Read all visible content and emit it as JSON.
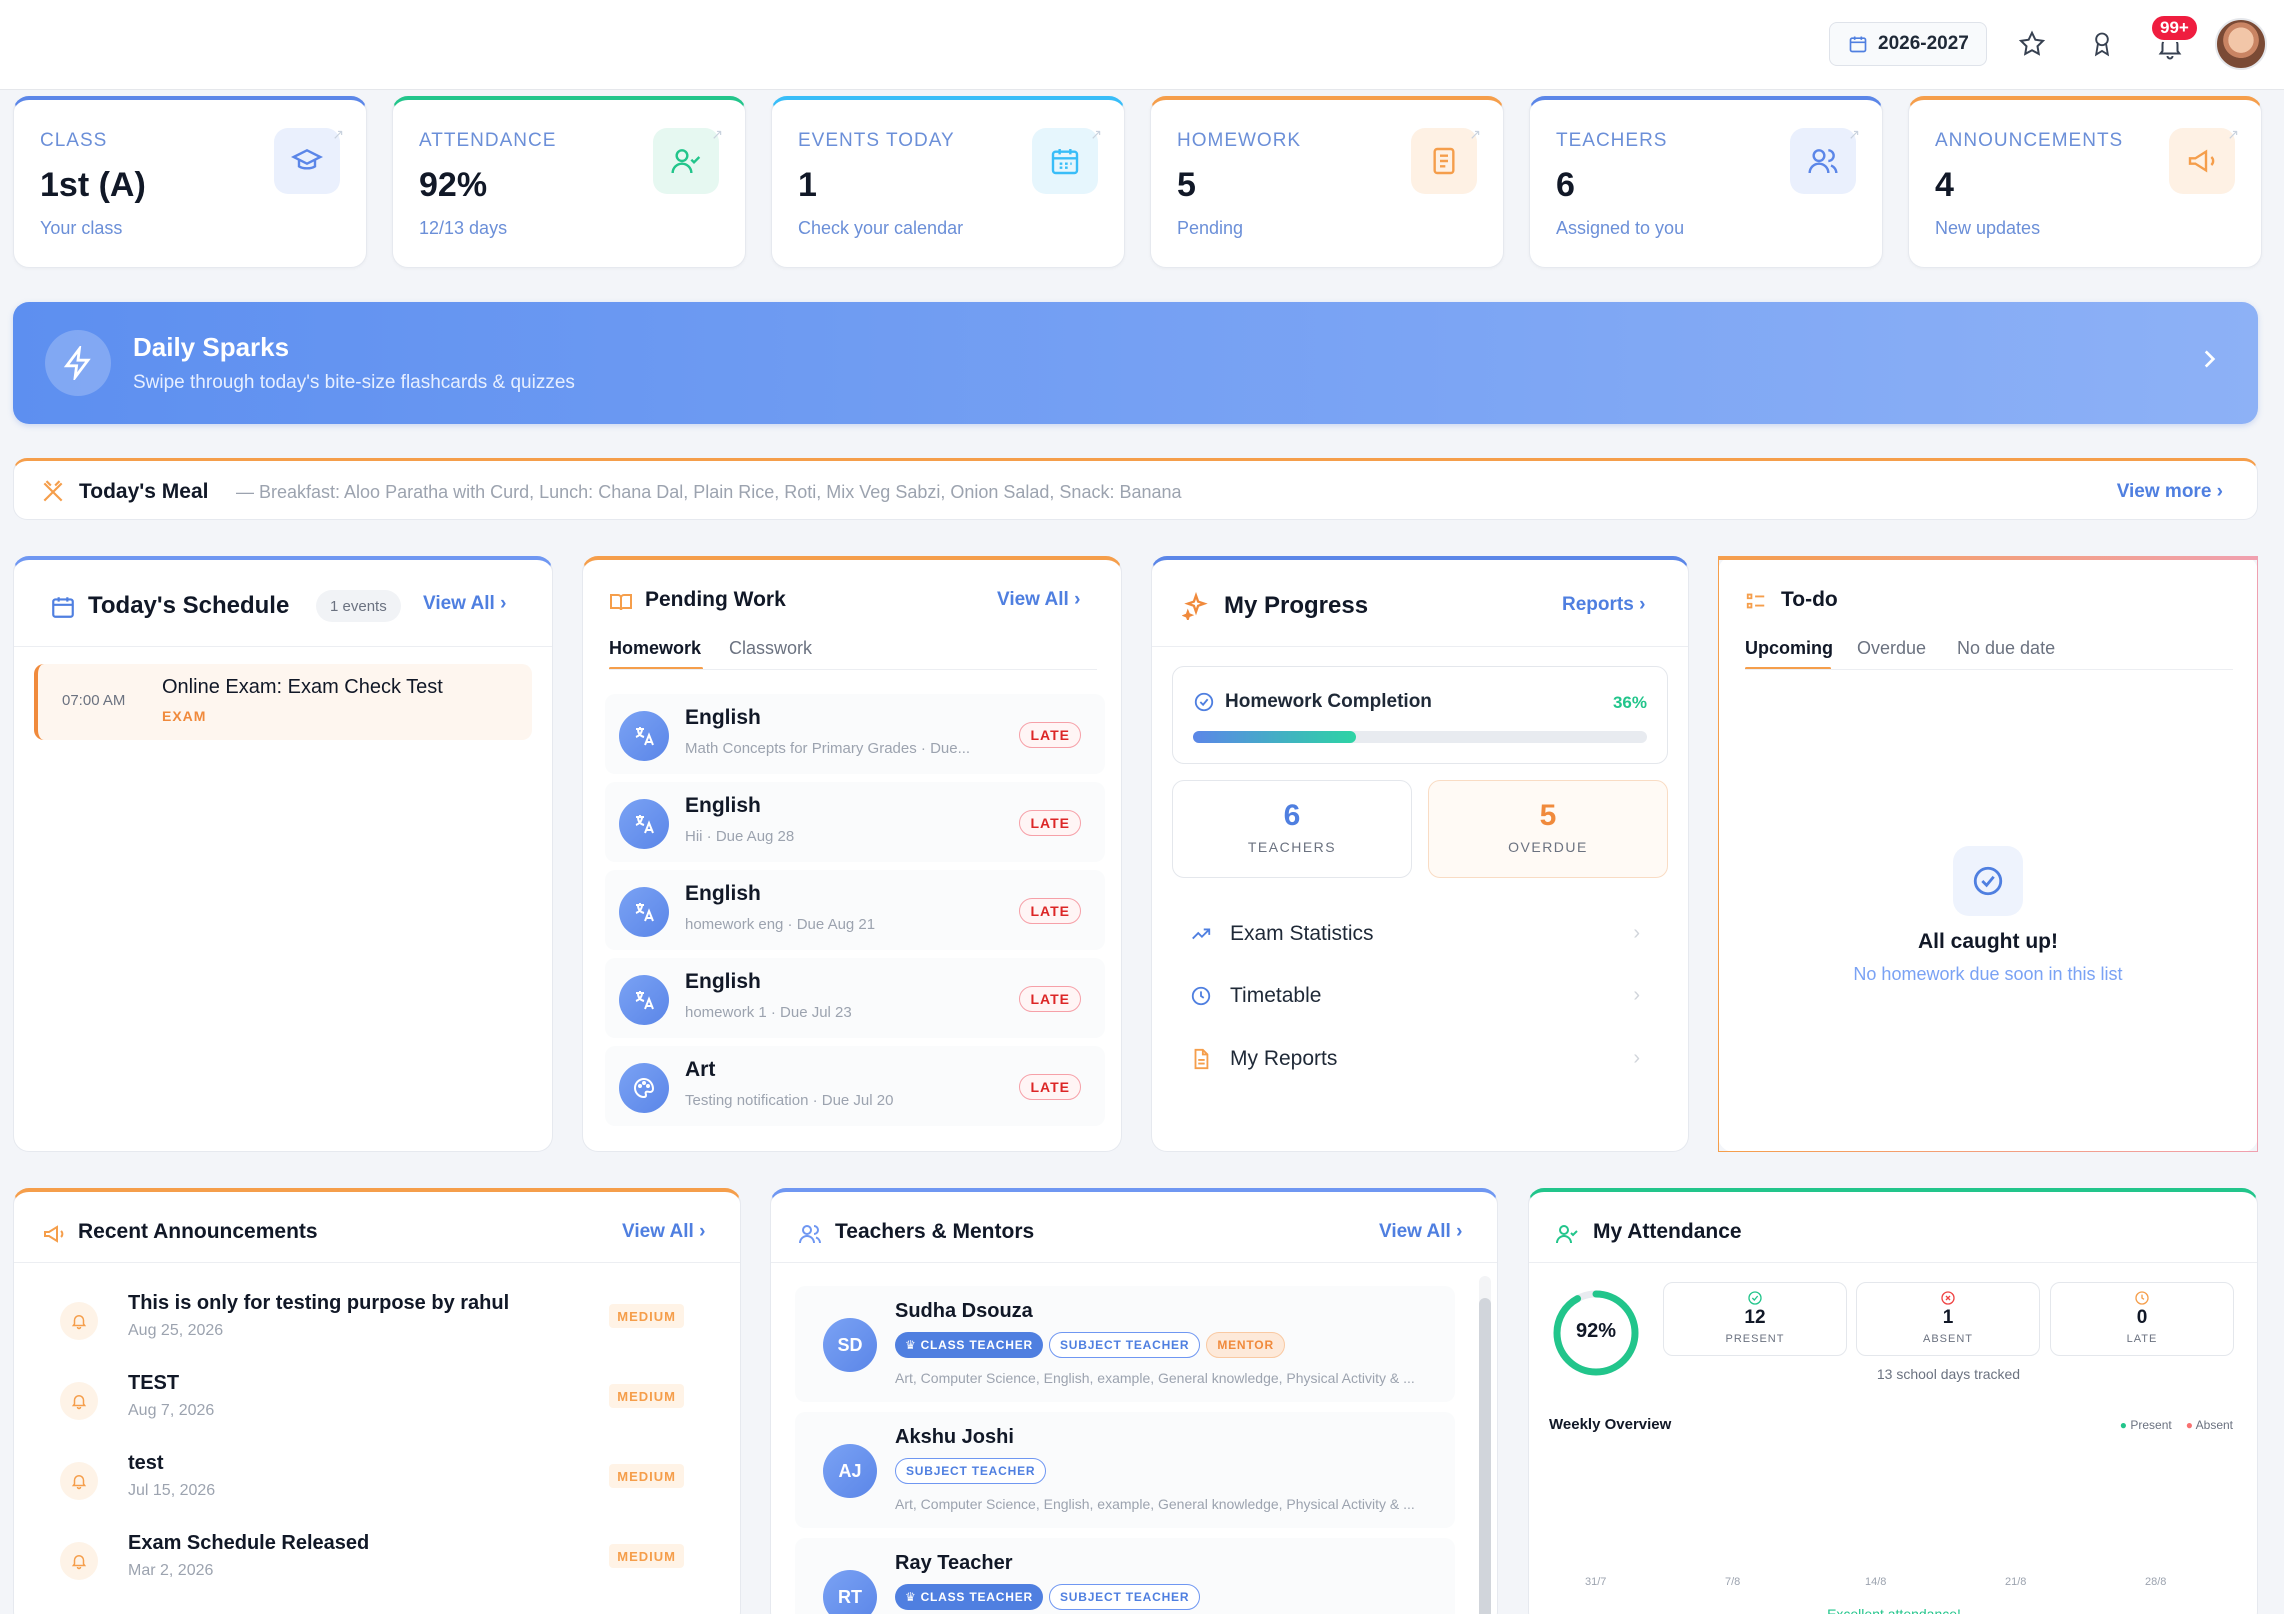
{
  "header": {
    "year": "2026-2027",
    "notifications_badge": "99+"
  },
  "stats": [
    {
      "label": "CLASS",
      "value": "1st (A)",
      "sub": "Your class",
      "icon": "graduation-cap-icon",
      "color": "#5b86e8"
    },
    {
      "label": "ATTENDANCE",
      "value": "92%",
      "sub": "12/13 days",
      "icon": "user-check-icon",
      "color": "#22c58b"
    },
    {
      "label": "EVENTS TODAY",
      "value": "1",
      "sub": "Check your calendar",
      "icon": "calendar-icon",
      "color": "#38bdf8"
    },
    {
      "label": "HOMEWORK",
      "value": "5",
      "sub": "Pending",
      "icon": "notebook-icon",
      "color": "#f59e4b"
    },
    {
      "label": "TEACHERS",
      "value": "6",
      "sub": "Assigned to you",
      "icon": "users-icon",
      "color": "#5b86e8"
    },
    {
      "label": "ANNOUNCEMENTS",
      "value": "4",
      "sub": "New updates",
      "icon": "megaphone-icon",
      "color": "#f59e4b"
    }
  ],
  "daily_sparks": {
    "title": "Daily Sparks",
    "subtitle": "Swipe through today's bite-size flashcards & quizzes"
  },
  "meal": {
    "title": "Today's Meal",
    "details": "— Breakfast: Aloo Paratha with Curd, Lunch: Chana Dal, Plain Rice, Roti, Mix Veg Sabzi, Onion Salad, Snack: Banana",
    "view_more": "View more"
  },
  "schedule": {
    "title": "Today's Schedule",
    "count": "1 events",
    "view_all": "View All",
    "items": [
      {
        "time": "07:00 AM",
        "title": "Online Exam: Exam Check Test",
        "type": "EXAM"
      }
    ]
  },
  "pending_work": {
    "title": "Pending Work",
    "view_all": "View All",
    "tabs": [
      "Homework",
      "Classwork"
    ],
    "items": [
      {
        "subject": "English",
        "detail": "Math Concepts for Primary Grades · Due...",
        "status": "LATE",
        "icon": "translate-icon"
      },
      {
        "subject": "English",
        "detail": "Hii · Due Aug 28",
        "status": "LATE",
        "icon": "translate-icon"
      },
      {
        "subject": "English",
        "detail": "homework eng · Due Aug 21",
        "status": "LATE",
        "icon": "translate-icon"
      },
      {
        "subject": "English",
        "detail": "homework 1 · Due Jul 23",
        "status": "LATE",
        "icon": "translate-icon"
      },
      {
        "subject": "Art",
        "detail": "Testing notification · Due Jul 20",
        "status": "LATE",
        "icon": "palette-icon"
      }
    ]
  },
  "progress": {
    "title": "My Progress",
    "reports": "Reports",
    "completion_label": "Homework Completion",
    "completion_value": "36%",
    "completion_fraction": 0.36,
    "teachers_count": "6",
    "teachers_label": "TEACHERS",
    "overdue_count": "5",
    "overdue_label": "OVERDUE",
    "links": [
      "Exam Statistics",
      "Timetable",
      "My Reports"
    ]
  },
  "todo": {
    "title": "To-do",
    "tabs": [
      "Upcoming",
      "Overdue",
      "No due date"
    ],
    "empty_title": "All caught up!",
    "empty_sub": "No homework due soon in this list"
  },
  "announcements": {
    "title": "Recent Announcements",
    "view_all": "View All",
    "items": [
      {
        "title": "This is only for testing purpose by rahul",
        "date": "Aug 25, 2026",
        "priority": "MEDIUM"
      },
      {
        "title": "TEST",
        "date": "Aug 7, 2026",
        "priority": "MEDIUM"
      },
      {
        "title": "test",
        "date": "Jul 15, 2026",
        "priority": "MEDIUM"
      },
      {
        "title": "Exam Schedule Released",
        "date": "Mar 2, 2026",
        "priority": "MEDIUM"
      }
    ]
  },
  "teachers": {
    "title": "Teachers & Mentors",
    "view_all": "View All",
    "items": [
      {
        "initials": "SD",
        "name": "Sudha Dsouza",
        "tags": [
          "CLASS TEACHER",
          "SUBJECT TEACHER",
          "MENTOR"
        ],
        "subjects": "Art, Computer Science, English, example, General knowledge, Physical Activity & ..."
      },
      {
        "initials": "AJ",
        "name": "Akshu Joshi",
        "tags": [
          "SUBJECT TEACHER"
        ],
        "subjects": "Art, Computer Science, English, example, General knowledge, Physical Activity & ..."
      },
      {
        "initials": "RT",
        "name": "Ray Teacher",
        "tags": [
          "CLASS TEACHER",
          "SUBJECT TEACHER"
        ],
        "subjects": ""
      }
    ]
  },
  "attendance": {
    "title": "My Attendance",
    "percent": "92%",
    "fraction": 0.92,
    "present": "12",
    "present_label": "PRESENT",
    "absent": "1",
    "absent_label": "ABSENT",
    "late": "0",
    "late_label": "LATE",
    "tracked": "13 school days tracked",
    "weekly_title": "Weekly Overview",
    "legend_present": "Present",
    "legend_absent": "Absent",
    "weeks": [
      "31/7",
      "7/8",
      "14/8",
      "21/8",
      "28/8"
    ],
    "footer": "Excellent attendance!"
  },
  "colors": {
    "accent": "#4f7fe0",
    "orange": "#f59e4b",
    "green": "#22c58b",
    "red": "#ef1d3f"
  }
}
